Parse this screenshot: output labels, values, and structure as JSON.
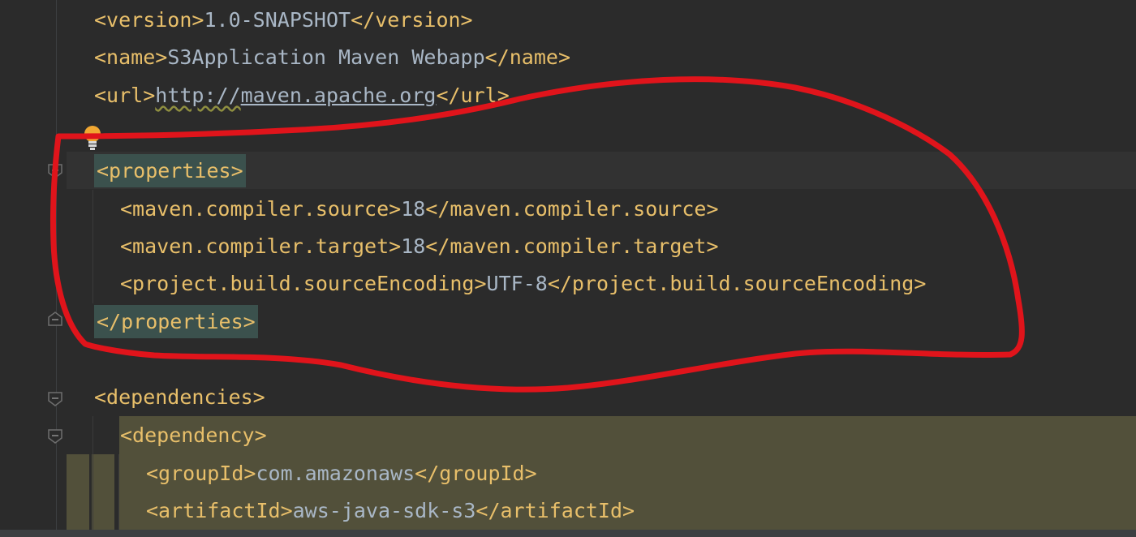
{
  "editor": {
    "language": "xml",
    "theme_colors": {
      "background": "#2b2b2b",
      "tag": "#e8bf6a",
      "text": "#a9b7c6",
      "current_line": "#323232",
      "tag_match_highlight": "#3b514d",
      "dependency_highlight": "#52503a",
      "annotation_red": "#e0141b"
    },
    "lines": [
      {
        "open": "<version>",
        "value": "1.0-SNAPSHOT",
        "close": "</version>"
      },
      {
        "open": "<name>",
        "value": "S3Application Maven Webapp",
        "close": "</name>"
      },
      {
        "open": "<url>",
        "value_prefix": "http://",
        "value_link": "maven.apache.org",
        "close": "</url>"
      },
      {
        "tag": "<properties>"
      },
      {
        "open": "<maven.compiler.source>",
        "value": "18",
        "close": "</maven.compiler.source>"
      },
      {
        "open": "<maven.compiler.target>",
        "value": "18",
        "close": "</maven.compiler.target>"
      },
      {
        "open": "<project.build.sourceEncoding>",
        "value": "UTF-8",
        "close": "</project.build.sourceEncoding>"
      },
      {
        "tag": "</properties>"
      },
      {
        "tag": "<dependencies>"
      },
      {
        "tag": "<dependency>"
      },
      {
        "open": "<groupId>",
        "value": "com.amazonaws",
        "close": "</groupId>"
      },
      {
        "open": "<artifactId>",
        "value": "aws-java-sdk-s3",
        "close": "</artifactId>"
      }
    ]
  },
  "gutter": {
    "icons": [
      "lightbulb-icon",
      "fold-properties-icon",
      "fold-end-properties-icon",
      "fold-dependencies-icon",
      "fold-dependency-icon"
    ]
  },
  "annotation": {
    "type": "hand-drawn red outline",
    "color": "#e0141b"
  }
}
